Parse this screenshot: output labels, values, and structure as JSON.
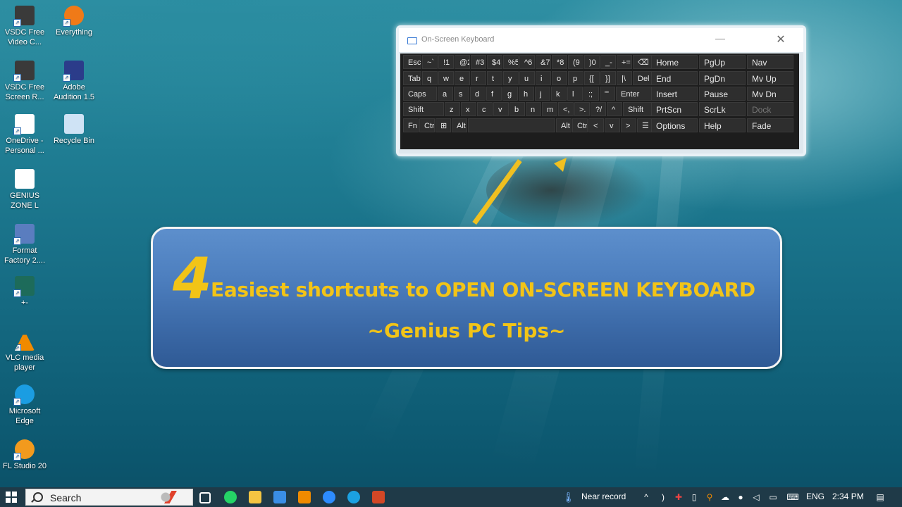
{
  "desktop": {
    "icons": [
      {
        "label": "VSDC Free Video C...",
        "icon": "vsdc-video-icon",
        "color": "#3a3a3a"
      },
      {
        "label": "Everything",
        "icon": "everything-search-icon",
        "color": "#f07a18"
      },
      {
        "label": "VSDC Free Screen R...",
        "icon": "vsdc-screen-recorder-icon",
        "color": "#3a3a3a"
      },
      {
        "label": "Adobe Audition 1.5",
        "icon": "adobe-audition-icon",
        "color": "#2b3c8a"
      },
      {
        "label": "OneDrive - Personal ...",
        "icon": "onedrive-file-icon",
        "color": "#ffffff"
      },
      {
        "label": "Recycle Bin",
        "icon": "recycle-bin-icon",
        "color": "#cfe3f5"
      },
      {
        "label": "GENIUS ZONE L",
        "icon": "document-icon",
        "color": "#ffffff"
      },
      {
        "label": "Format Factory 2....",
        "icon": "format-factory-icon",
        "color": "#5a7dbf"
      },
      {
        "label": "+-",
        "icon": "video-file-icon",
        "color": "#1d6b5a"
      },
      {
        "label": "VLC media player",
        "icon": "vlc-cone-icon",
        "color": "#f08a00"
      },
      {
        "label": "Microsoft Edge",
        "icon": "edge-icon",
        "color": "#1b9de2"
      },
      {
        "label": "FL Studio 20",
        "icon": "fl-studio-icon",
        "color": "#f29a1d"
      }
    ]
  },
  "osk": {
    "title": "On-Screen Keyboard",
    "minimize": "—",
    "close": "✕",
    "rows": [
      [
        "Esc",
        "~`",
        "!1",
        "@2",
        "#3",
        "$4",
        "%5",
        "^6",
        "&7",
        "*8",
        "(9",
        ")0",
        "_-",
        "+=",
        "⌫"
      ],
      [
        "Tab",
        "q",
        "w",
        "e",
        "r",
        "t",
        "y",
        "u",
        "i",
        "o",
        "p",
        "{[",
        "}]",
        "|\\",
        "Del"
      ],
      [
        "Caps",
        "a",
        "s",
        "d",
        "f",
        "g",
        "h",
        "j",
        "k",
        "l",
        ":;",
        "\"'",
        "Enter"
      ],
      [
        "Shift",
        "z",
        "x",
        "c",
        "v",
        "b",
        "n",
        "m",
        "<,",
        ">.",
        "?/",
        "^",
        "Shift"
      ],
      [
        "Fn",
        "Ctrl",
        "⊞",
        "Alt",
        "",
        "Alt",
        "Ctrl",
        "<",
        "v",
        ">",
        "☰"
      ]
    ],
    "nav_keys": [
      [
        "Home",
        "PgUp",
        "Nav"
      ],
      [
        "End",
        "PgDn",
        "Mv Up"
      ],
      [
        "Insert",
        "Pause",
        "Mv Dn"
      ],
      [
        "PrtScn",
        "ScrLk",
        "Dock"
      ],
      [
        "Options",
        "Help",
        "Fade"
      ]
    ]
  },
  "banner": {
    "number": "4",
    "headline": "Easiest shortcuts to OPEN ON-SCREEN KEYBOARD",
    "subtitle": "~Genius PC Tips~",
    "text_color": "#f2c417"
  },
  "taskbar": {
    "search_label": "Search",
    "weather": "Near record",
    "language": "ENG",
    "time": "2:34 PM",
    "apps": [
      "task-view-icon",
      "whatsapp-icon",
      "file-explorer-icon",
      "store-icon",
      "vlc-icon",
      "zoom-icon",
      "edge-icon",
      "powerpoint-icon"
    ]
  }
}
